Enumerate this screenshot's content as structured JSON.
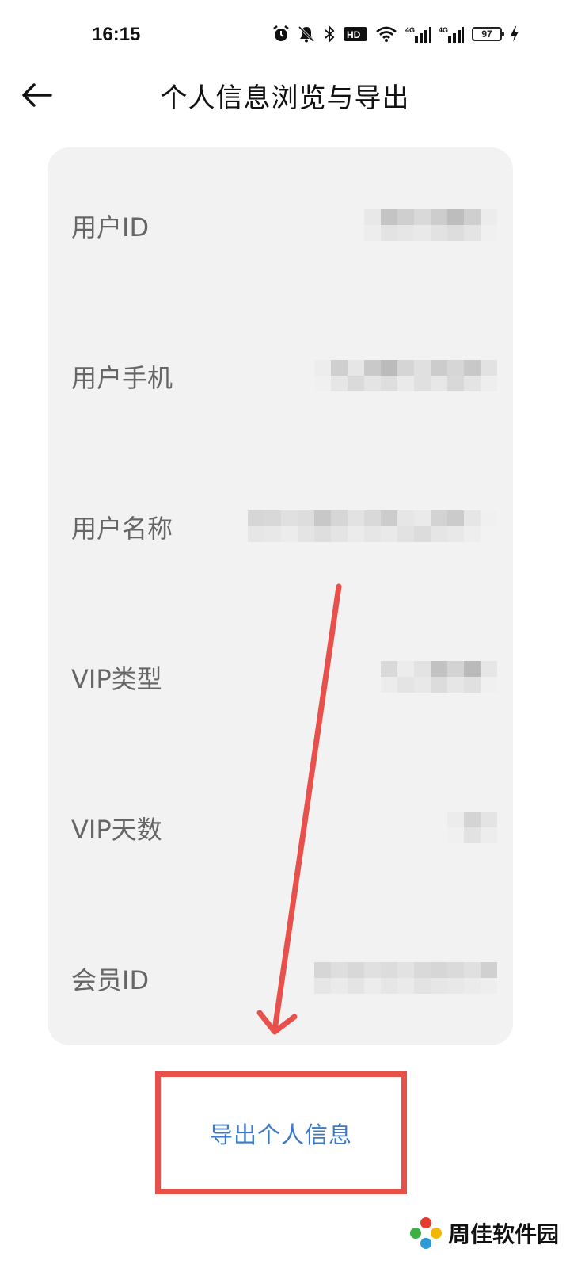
{
  "status_bar": {
    "time": "16:15",
    "battery": "97",
    "hd_label": "HD",
    "net_label_1": "4G",
    "net_label_2": "4G",
    "icons": [
      "alarm-icon",
      "mute-icon",
      "bluetooth-icon",
      "hd-icon",
      "wifi-icon",
      "signal-icon",
      "signal-icon",
      "battery-icon",
      "charging-icon"
    ]
  },
  "header": {
    "title": "个人信息浏览与导出",
    "back_icon": "arrow-left-icon"
  },
  "card": {
    "rows": [
      {
        "label": "用户ID"
      },
      {
        "label": "用户手机"
      },
      {
        "label": "用户名称"
      },
      {
        "label": "VIP类型"
      },
      {
        "label": "VIP天数"
      },
      {
        "label": "会员ID"
      }
    ],
    "values_note_color": "#c8c8c8"
  },
  "export": {
    "label": "导出个人信息",
    "highlight_color": "#e8504b",
    "text_color": "#3b79c9"
  },
  "watermark": {
    "text": "周佳软件园"
  }
}
